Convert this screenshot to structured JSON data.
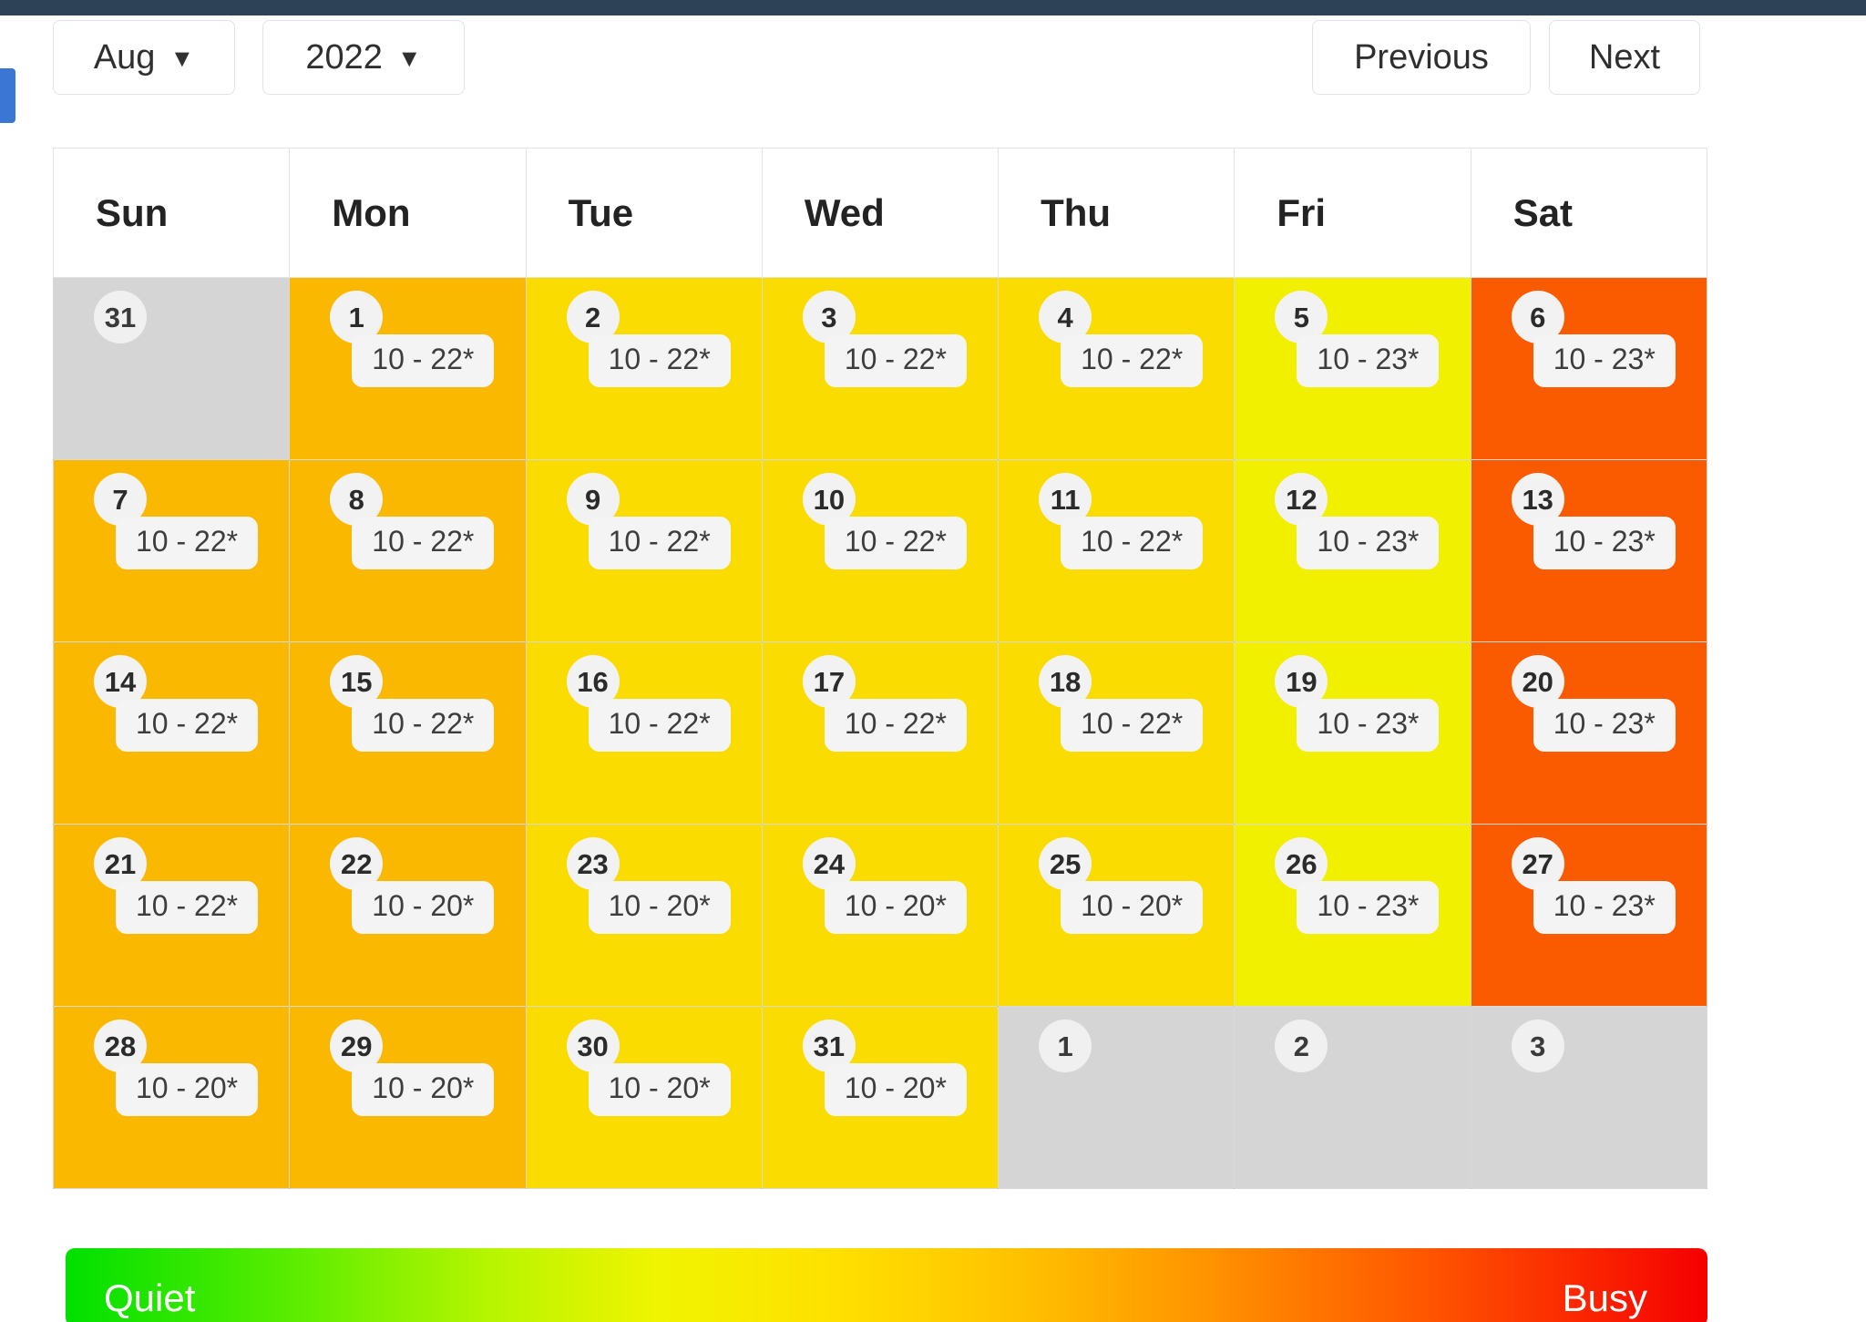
{
  "theme": {
    "topbar_color": "#2d4256",
    "side_handle_color": "#3a77d4",
    "out_of_month_color": "#d5d5d5",
    "busy_levels": {
      "amber": "#fab900",
      "gold": "#fadc00",
      "yellow": "#f0f000",
      "orange": "#fa5a00"
    }
  },
  "toolbar": {
    "month_label": "Aug",
    "year_label": "2022",
    "caret_glyph": "▼",
    "previous_label": "Previous",
    "next_label": "Next"
  },
  "calendar": {
    "weekday_headers": [
      "Sun",
      "Mon",
      "Tue",
      "Wed",
      "Thu",
      "Fri",
      "Sat"
    ],
    "weeks": [
      [
        {
          "day": "31",
          "hours": "",
          "bg": "#d5d5d5",
          "in_month": false
        },
        {
          "day": "1",
          "hours": "10 - 22*",
          "bg": "#fab900",
          "in_month": true
        },
        {
          "day": "2",
          "hours": "10 - 22*",
          "bg": "#fadc00",
          "in_month": true
        },
        {
          "day": "3",
          "hours": "10 - 22*",
          "bg": "#fadc00",
          "in_month": true
        },
        {
          "day": "4",
          "hours": "10 - 22*",
          "bg": "#fadc00",
          "in_month": true
        },
        {
          "day": "5",
          "hours": "10 - 23*",
          "bg": "#f0f000",
          "in_month": true
        },
        {
          "day": "6",
          "hours": "10 - 23*",
          "bg": "#fa5a00",
          "in_month": true
        }
      ],
      [
        {
          "day": "7",
          "hours": "10 - 22*",
          "bg": "#fab900",
          "in_month": true
        },
        {
          "day": "8",
          "hours": "10 - 22*",
          "bg": "#fab900",
          "in_month": true
        },
        {
          "day": "9",
          "hours": "10 - 22*",
          "bg": "#fadc00",
          "in_month": true
        },
        {
          "day": "10",
          "hours": "10 - 22*",
          "bg": "#fadc00",
          "in_month": true
        },
        {
          "day": "11",
          "hours": "10 - 22*",
          "bg": "#fadc00",
          "in_month": true
        },
        {
          "day": "12",
          "hours": "10 - 23*",
          "bg": "#f0f000",
          "in_month": true
        },
        {
          "day": "13",
          "hours": "10 - 23*",
          "bg": "#fa5a00",
          "in_month": true
        }
      ],
      [
        {
          "day": "14",
          "hours": "10 - 22*",
          "bg": "#fab900",
          "in_month": true
        },
        {
          "day": "15",
          "hours": "10 - 22*",
          "bg": "#fab900",
          "in_month": true
        },
        {
          "day": "16",
          "hours": "10 - 22*",
          "bg": "#fadc00",
          "in_month": true
        },
        {
          "day": "17",
          "hours": "10 - 22*",
          "bg": "#fadc00",
          "in_month": true
        },
        {
          "day": "18",
          "hours": "10 - 22*",
          "bg": "#fadc00",
          "in_month": true
        },
        {
          "day": "19",
          "hours": "10 - 23*",
          "bg": "#f0f000",
          "in_month": true
        },
        {
          "day": "20",
          "hours": "10 - 23*",
          "bg": "#fa5a00",
          "in_month": true
        }
      ],
      [
        {
          "day": "21",
          "hours": "10 - 22*",
          "bg": "#fab900",
          "in_month": true
        },
        {
          "day": "22",
          "hours": "10 - 20*",
          "bg": "#fab900",
          "in_month": true
        },
        {
          "day": "23",
          "hours": "10 - 20*",
          "bg": "#fadc00",
          "in_month": true
        },
        {
          "day": "24",
          "hours": "10 - 20*",
          "bg": "#fadc00",
          "in_month": true
        },
        {
          "day": "25",
          "hours": "10 - 20*",
          "bg": "#fadc00",
          "in_month": true
        },
        {
          "day": "26",
          "hours": "10 - 23*",
          "bg": "#f0f000",
          "in_month": true
        },
        {
          "day": "27",
          "hours": "10 - 23*",
          "bg": "#fa5a00",
          "in_month": true
        }
      ],
      [
        {
          "day": "28",
          "hours": "10 - 20*",
          "bg": "#fab900",
          "in_month": true
        },
        {
          "day": "29",
          "hours": "10 - 20*",
          "bg": "#fab900",
          "in_month": true
        },
        {
          "day": "30",
          "hours": "10 - 20*",
          "bg": "#fadc00",
          "in_month": true
        },
        {
          "day": "31",
          "hours": "10 - 20*",
          "bg": "#fadc00",
          "in_month": true
        },
        {
          "day": "1",
          "hours": "",
          "bg": "#d5d5d5",
          "in_month": false
        },
        {
          "day": "2",
          "hours": "",
          "bg": "#d5d5d5",
          "in_month": false
        },
        {
          "day": "3",
          "hours": "",
          "bg": "#d5d5d5",
          "in_month": false
        }
      ]
    ]
  },
  "legend": {
    "quiet_label": "Quiet",
    "busy_label": "Busy",
    "gradient_start": "#00e000",
    "gradient_end": "#f50000"
  }
}
